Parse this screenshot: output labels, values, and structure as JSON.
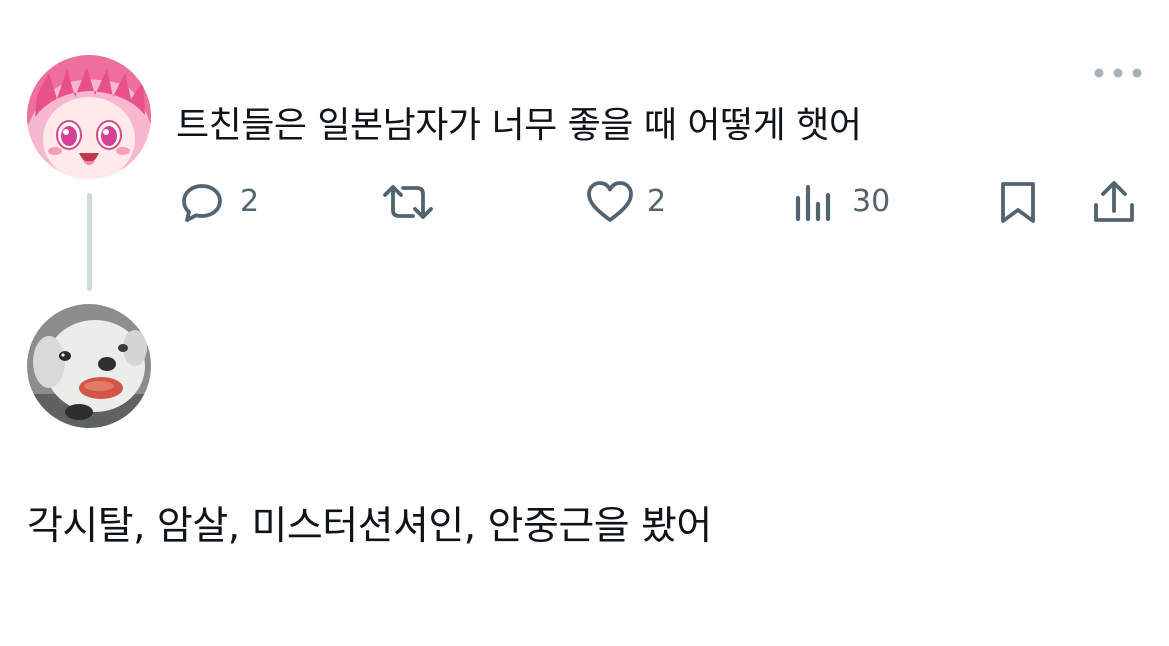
{
  "tweet": {
    "text": "트친들은 일본남자가 너무 좋을 때 어떻게 햇어",
    "actions": {
      "reply_count": "2",
      "like_count": "2",
      "views_count": "30"
    }
  },
  "reply": {
    "text": "각시탈, 암살, 미스터션셔인, 안중근을 봤어"
  },
  "colors": {
    "text": "#0f1419",
    "muted": "#536471",
    "thread_line": "#cfd9de"
  }
}
